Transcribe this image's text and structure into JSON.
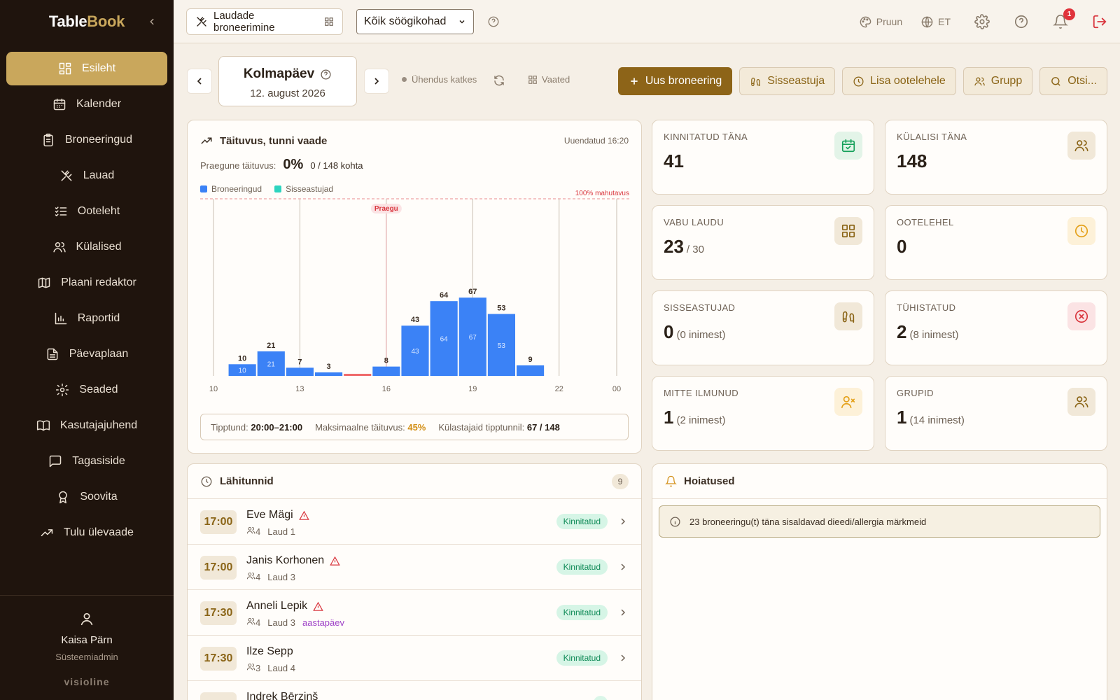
{
  "sidebar": {
    "brand_main": "Table",
    "brand_accent": "Book",
    "items": [
      {
        "label": "Esileht",
        "icon": "dashboard-icon"
      },
      {
        "label": "Kalender",
        "icon": "calendar-icon"
      },
      {
        "label": "Broneeringud",
        "icon": "clipboard-icon"
      },
      {
        "label": "Lauad",
        "icon": "utensils-icon"
      },
      {
        "label": "Ooteleht",
        "icon": "list-check-icon"
      },
      {
        "label": "Külalised",
        "icon": "users-icon"
      },
      {
        "label": "Plaani redaktor",
        "icon": "map-icon"
      },
      {
        "label": "Raportid",
        "icon": "bar-chart-icon"
      },
      {
        "label": "Päevaplaan",
        "icon": "document-icon"
      },
      {
        "label": "Seaded",
        "icon": "gear-icon"
      },
      {
        "label": "Kasutajajuhend",
        "icon": "book-icon"
      },
      {
        "label": "Tagasiside",
        "icon": "message-icon"
      },
      {
        "label": "Soovita",
        "icon": "award-icon"
      },
      {
        "label": "Tulu ülevaade",
        "icon": "trending-up-icon"
      }
    ],
    "user": {
      "name": "Kaisa Pärn",
      "role": "Süsteemiadmin"
    },
    "powered_by": "visioline"
  },
  "topbar": {
    "mode_label": "Laudade broneerimine",
    "venue_value": "Kõik söögikohad",
    "theme_label": "Pruun",
    "lang_label": "ET",
    "notif_count": "1"
  },
  "datebar": {
    "day": "Kolmapäev",
    "date": "12. august 2026",
    "connection": "Ühendus katkes",
    "views_label": "Vaated",
    "actions": {
      "new": "Uus broneering",
      "walkin": "Sisseastuja",
      "waitlist": "Lisa ootelehele",
      "group": "Grupp",
      "search": "Otsi..."
    }
  },
  "occupancy": {
    "title": "Täituvus, tunni vaade",
    "updated": "Uuendatud 16:20",
    "current_label": "Praegune täituvus:",
    "current_pct": "0%",
    "current_count": "0 / 148 kohta",
    "peak_label": "Tipptund:",
    "peak_value": "20:00–21:00",
    "max_label": "Maksimaalne täituvus:",
    "max_value": "45%",
    "guests_label": "Külastajaid tipptunnil:",
    "guests_value": "67 / 148"
  },
  "chart_data": {
    "type": "bar",
    "x_start": 10,
    "x_end": 24,
    "tick_labels": [
      "10",
      "13",
      "16",
      "19",
      "22",
      "00"
    ],
    "ylim": [
      0,
      148
    ],
    "categories": [
      "11:00",
      "12:00",
      "13:00",
      "14:00",
      "15:00",
      "16:00",
      "17:00",
      "18:00",
      "19:00",
      "20:00",
      "21:00",
      "22:00"
    ],
    "series": [
      {
        "name": "Broneeringud",
        "color": "#3b82f6",
        "values": [
          10,
          21,
          7,
          3,
          0,
          8,
          43,
          64,
          67,
          53,
          9,
          null
        ]
      },
      {
        "name": "Sisseastujad",
        "color": "#2dd4bf",
        "values": [
          0,
          0,
          0,
          0,
          0,
          0,
          0,
          0,
          0,
          0,
          0,
          0
        ]
      }
    ],
    "inner_labels": [
      10,
      21,
      null,
      null,
      null,
      null,
      43,
      64,
      67,
      53,
      null,
      null
    ],
    "capacity_label": "100% mahutavus",
    "now_label": "Praegu",
    "now_hour": 16,
    "grid": true
  },
  "stats": [
    {
      "label": "Kinnitatud täna",
      "value": "41",
      "sub": "",
      "icon": "calendar-check-icon",
      "color": "#15a05a",
      "bg": "#e3f4e8"
    },
    {
      "label": "Külalisi täna",
      "value": "148",
      "sub": "",
      "icon": "users-icon",
      "color": "#8a6416",
      "bg": "#f1e8d8"
    },
    {
      "label": "Vabu laudu",
      "value": "23",
      "sub": "/ 30",
      "icon": "grid-icon",
      "color": "#8a6416",
      "bg": "#f1e8d8"
    },
    {
      "label": "Ootelehel",
      "value": "0",
      "sub": "",
      "icon": "clock-icon",
      "color": "#e4a018",
      "bg": "#fdf1d8"
    },
    {
      "label": "Sisseastujad",
      "value": "0",
      "sub": "(0 inimest)",
      "icon": "footprints-icon",
      "color": "#8a6416",
      "bg": "#f1e8d8"
    },
    {
      "label": "Tühistatud",
      "value": "2",
      "sub": "(8 inimest)",
      "icon": "x-circle-icon",
      "color": "#d9363e",
      "bg": "#fbe3e4"
    },
    {
      "label": "Mitte ilmunud",
      "value": "1",
      "sub": "(2 inimest)",
      "icon": "user-x-icon",
      "color": "#e4a018",
      "bg": "#fdf1d8"
    },
    {
      "label": "Grupid",
      "value": "1",
      "sub": "(14 inimest)",
      "icon": "users-icon",
      "color": "#8a6416",
      "bg": "#f1e8d8"
    }
  ],
  "upcoming": {
    "title": "Lähitunnid",
    "count": "9",
    "rows": [
      {
        "time": "17:00",
        "name": "Eve Mägi",
        "guests": "4",
        "table": "Laud 1",
        "tag": "",
        "status": "Kinnitatud",
        "warn": true
      },
      {
        "time": "17:00",
        "name": "Janis Korhonen",
        "guests": "4",
        "table": "Laud 3",
        "tag": "",
        "status": "Kinnitatud",
        "warn": true
      },
      {
        "time": "17:30",
        "name": "Anneli Lepik",
        "guests": "4",
        "table": "Laud 3",
        "tag": "aastapäev",
        "status": "Kinnitatud",
        "warn": true
      },
      {
        "time": "17:30",
        "name": "Ilze Sepp",
        "guests": "3",
        "table": "Laud 4",
        "tag": "",
        "status": "Kinnitatud",
        "warn": false
      },
      {
        "time": "",
        "name": "Indrek Bērziņš",
        "guests": "",
        "table": "",
        "tag": "",
        "status": "",
        "warn": false
      }
    ]
  },
  "alerts": {
    "title": "Hoiatused",
    "items": [
      "23 broneeringu(t) täna sisaldavad dieedi/allergia märkmeid"
    ]
  }
}
